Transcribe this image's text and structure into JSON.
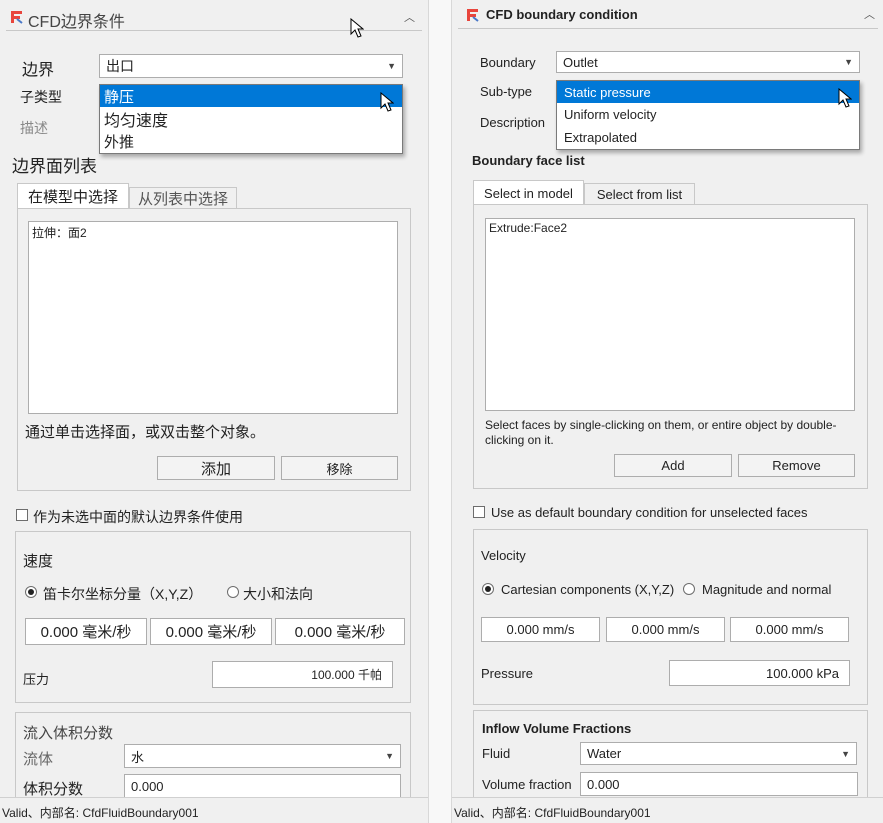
{
  "left": {
    "title": "CFD边界条件",
    "boundary_label": "边界",
    "boundary_value": "出口",
    "subtype_label": "子类型",
    "description_label": "描述",
    "subtype_options": [
      "静压",
      "均匀速度",
      "外推"
    ],
    "face_list_title": "边界面列表",
    "tabs": [
      "在模型中选择",
      "从列表中选择"
    ],
    "faces": [
      "拉伸：面2"
    ],
    "hint": "通过单击选择面，或双击整个对象。",
    "add_label": "添加",
    "remove_label": "移除",
    "default_checkbox": "作为未选中面的默认边界条件使用",
    "velocity_title": "速度",
    "radio_cartesian": "笛卡尔坐标分量（X,Y,Z）",
    "radio_magnitude": "大小和法向",
    "velocity_values": [
      "0.000 毫米/秒",
      "0.000 毫米/秒",
      "0.000 毫米/秒"
    ],
    "pressure_label": "压力",
    "pressure_value": "100.000 千帕",
    "inflow_title": "流入体积分数",
    "fluid_label": "流体",
    "fluid_value": "水",
    "volume_label": "体积分数",
    "volume_value": "0.000",
    "status": "Valid、内部名: CfdFluidBoundary001"
  },
  "right": {
    "title": "CFD boundary condition",
    "boundary_label": "Boundary",
    "boundary_value": "Outlet",
    "subtype_label": "Sub-type",
    "description_label": "Description",
    "subtype_options": [
      "Static pressure",
      "Uniform velocity",
      "Extrapolated"
    ],
    "face_list_title": "Boundary face list",
    "tabs": [
      "Select in model",
      "Select from list"
    ],
    "faces": [
      "Extrude:Face2"
    ],
    "hint": "Select faces by single-clicking on them, or entire object by double-clicking on it.",
    "add_label": "Add",
    "remove_label": "Remove",
    "default_checkbox": "Use as default boundary condition for unselected faces",
    "velocity_title": "Velocity",
    "radio_cartesian": "Cartesian components (X,Y,Z)",
    "radio_magnitude": "Magnitude and normal",
    "velocity_values": [
      "0.000 mm/s",
      "0.000 mm/s",
      "0.000 mm/s"
    ],
    "pressure_label": "Pressure",
    "pressure_value": "100.000 kPa",
    "inflow_title": "Inflow Volume Fractions",
    "fluid_label": "Fluid",
    "fluid_value": "Water",
    "volume_label": "Volume fraction",
    "volume_value": "0.000",
    "status": "Valid、内部名: CfdFluidBoundary001"
  },
  "colors": {
    "selection": "#0078d7",
    "logo": "#e8453c"
  },
  "icons": [
    "cfd-logo-icon",
    "collapse-chevron-icon",
    "dropdown-arrow-icon",
    "mouse-cursor-icon"
  ]
}
